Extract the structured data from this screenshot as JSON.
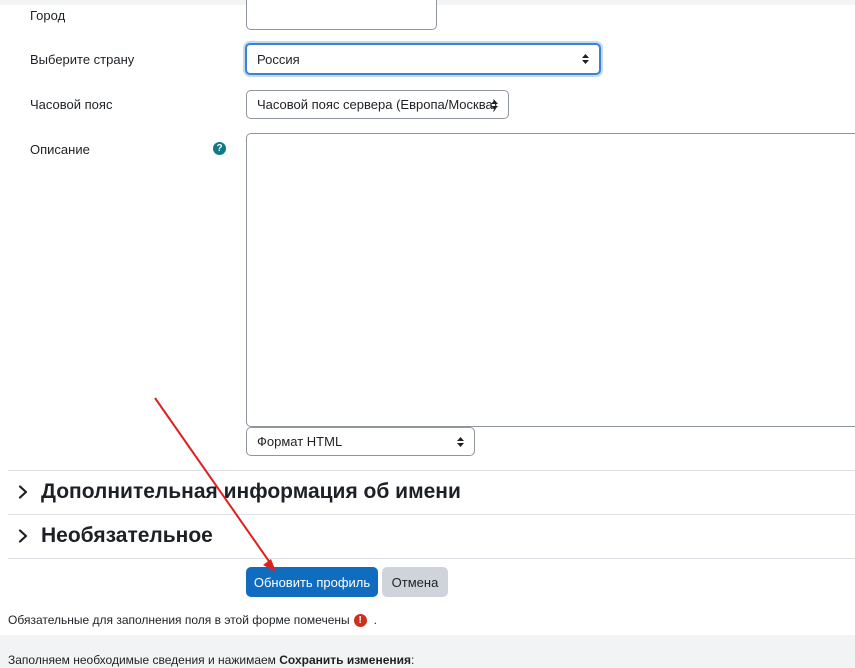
{
  "form": {
    "city_label": "Город",
    "country_label": "Выберите страну",
    "country_value": "Россия",
    "timezone_label": "Часовой пояс",
    "timezone_value": "Часовой пояс сервера (Европа/Москва)",
    "description_label": "Описание",
    "help_glyph": "?",
    "format_value": "Формат HTML"
  },
  "sections": [
    {
      "label": "Дополнительная информация об имени"
    },
    {
      "label": "Необязательное"
    }
  ],
  "buttons": {
    "update_profile": "Обновить профиль",
    "cancel": "Отмена"
  },
  "required_note": {
    "text": "Обязательные для заполнения поля в этой форме помечены",
    "icon_glyph": "!",
    "suffix": "."
  },
  "instruction": {
    "prefix": "Заполняем необходимые сведения и нажимаем ",
    "bold": "Сохранить изменения",
    "suffix": ":"
  },
  "colors": {
    "primary": "#0f6cbf",
    "help": "#0f7a86",
    "required": "#ca3120",
    "annotation_arrow": "#e02020"
  },
  "icons": {
    "help": "question-circle-icon",
    "required": "exclamation-circle-icon",
    "section": "chevron-right-icon",
    "select": "sort-arrows-icon"
  }
}
